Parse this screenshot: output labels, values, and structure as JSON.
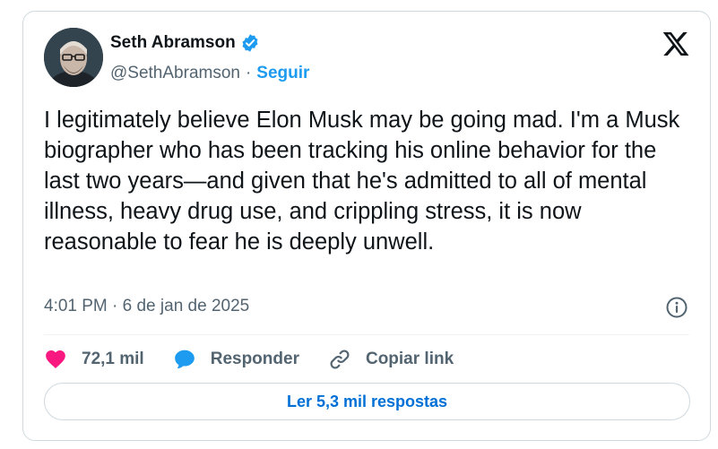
{
  "author": {
    "name": "Seth Abramson",
    "handle": "@SethAbramson",
    "separator": "·",
    "follow_label": "Seguir",
    "verified": true
  },
  "tweet": {
    "text": "I legitimately believe Elon Musk may be going mad. I'm a Musk biographer who has been tracking his online behavior for the last two years—and given that he's admitted to all of mental illness, heavy drug use, and crippling stress, it is now reasonable to fear he is deeply unwell.",
    "timestamp": "4:01 PM · 6 de jan de 2025"
  },
  "actions": {
    "likes": "72,1 mil",
    "reply_label": "Responder",
    "copy_link_label": "Copiar link"
  },
  "replies_button": "Ler 5,3 mil respostas",
  "icons": {
    "verified": "verified-badge-icon",
    "brand": "x-logo-icon",
    "info": "info-icon",
    "like": "heart-icon",
    "reply": "speech-bubble-icon",
    "link": "link-icon"
  },
  "colors": {
    "accent": "#1d9bf0",
    "like": "#f91880",
    "text": "#0f1419",
    "muted": "#536471",
    "border": "#cfd9de"
  }
}
